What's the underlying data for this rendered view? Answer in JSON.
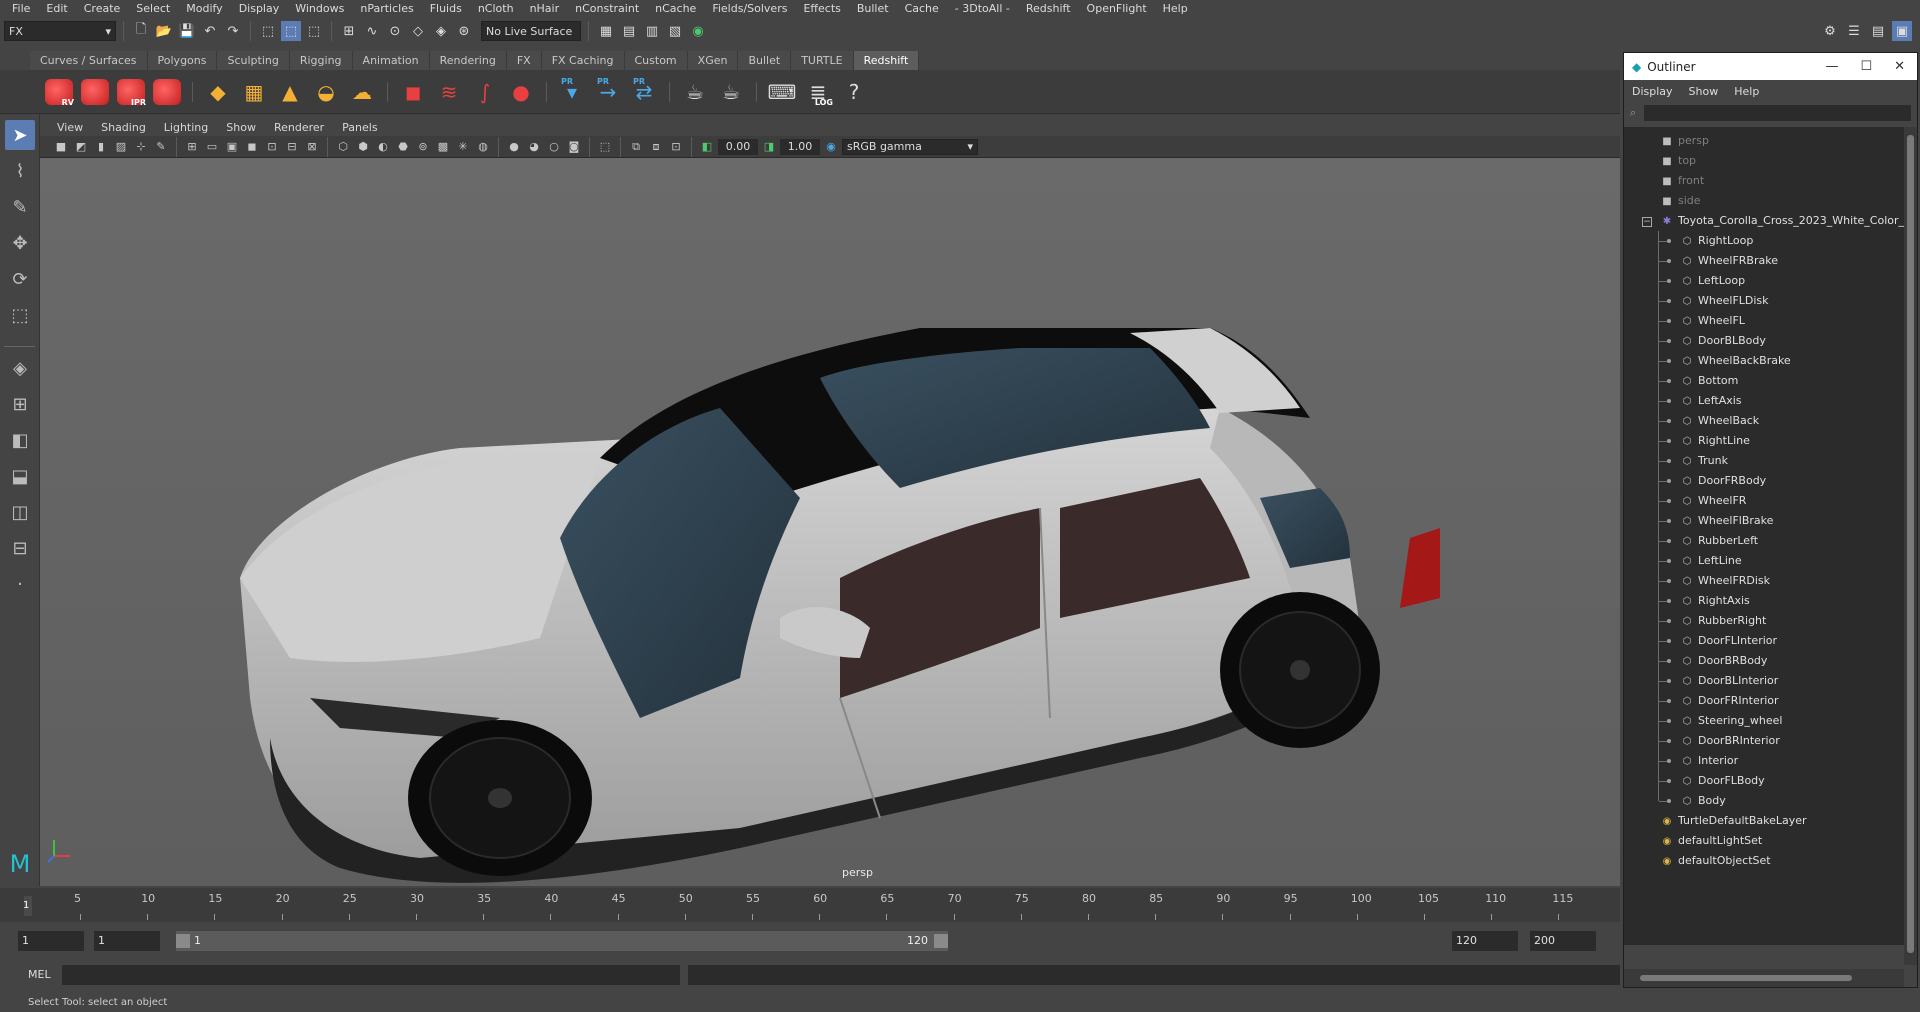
{
  "menubar": {
    "items": [
      "File",
      "Edit",
      "Create",
      "Select",
      "Modify",
      "Display",
      "Windows",
      "nParticles",
      "Fluids",
      "nCloth",
      "nHair",
      "nConstraint",
      "nCache",
      "Fields/Solvers",
      "Effects",
      "Bullet",
      "Cache",
      "- 3DtoAll -",
      "Redshift",
      "OpenFlight",
      "Help"
    ]
  },
  "statusline": {
    "menuset": "FX",
    "live_surface": "No Live Surface"
  },
  "shelf": {
    "tabs": [
      "Curves / Surfaces",
      "Polygons",
      "Sculpting",
      "Rigging",
      "Animation",
      "Rendering",
      "FX",
      "FX Caching",
      "Custom",
      "XGen",
      "Bullet",
      "TURTLE",
      "Redshift"
    ],
    "active_tab": "Redshift",
    "icon_labels": {
      "rv": "RV",
      "ipr": "IPR",
      "pr1": "PR",
      "pr2": "PR",
      "pr3": "PR",
      "log": "LOG"
    }
  },
  "panel": {
    "menu": [
      "View",
      "Shading",
      "Lighting",
      "Show",
      "Renderer",
      "Panels"
    ],
    "exposure": "0.00",
    "gamma": "1.00",
    "colorspace": "sRGB gamma",
    "camera_label": "persp"
  },
  "timeline": {
    "ticks": [
      "5",
      "10",
      "15",
      "20",
      "25",
      "30",
      "35",
      "40",
      "45",
      "50",
      "55",
      "60",
      "65",
      "70",
      "75",
      "80",
      "85",
      "90",
      "95",
      "100",
      "105",
      "110",
      "115"
    ],
    "current_frame": "1",
    "range_start": "1",
    "range_start_inner": "1",
    "range_slider_start": "1",
    "range_slider_end": "120",
    "range_end": "120",
    "anim_end": "200"
  },
  "commandline": {
    "label": "MEL"
  },
  "helpline": {
    "text": "Select Tool: select an object"
  },
  "outliner": {
    "title": "Outliner",
    "menu": [
      "Display",
      "Show",
      "Help"
    ],
    "cameras": [
      "persp",
      "top",
      "front",
      "side"
    ],
    "group": "Toyota_Corolla_Cross_2023_White_Color_",
    "children": [
      "RightLoop",
      "WheelFRBrake",
      "LeftLoop",
      "WheelFLDisk",
      "WheelFL",
      "DoorBLBody",
      "WheelBackBrake",
      "Bottom",
      "LeftAxis",
      "WheelBack",
      "RightLine",
      "Trunk",
      "DoorFRBody",
      "WheelFR",
      "WheelFlBrake",
      "RubberLeft",
      "LeftLine",
      "WheelFRDisk",
      "RightAxis",
      "RubberRight",
      "DoorFLInterior",
      "DoorBRBody",
      "DoorBLInterior",
      "DoorFRInterior",
      "Steering_wheel",
      "DoorBRInterior",
      "Interior",
      "DoorFLBody",
      "Body"
    ],
    "sets": [
      "TurtleDefaultBakeLayer",
      "defaultLightSet",
      "defaultObjectSet"
    ]
  }
}
